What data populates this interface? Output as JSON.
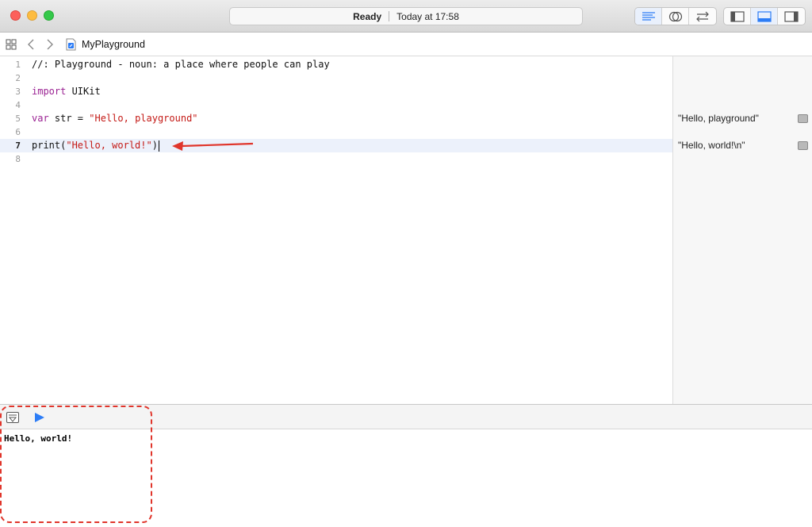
{
  "window": {
    "status_ready": "Ready",
    "status_time": "Today at 17:58"
  },
  "toolbar": {
    "editor_modes": [
      "standard-editor-icon",
      "assistant-editor-icon",
      "version-editor-icon"
    ],
    "view_toggles": [
      "navigator-panel-icon",
      "debug-area-icon",
      "utilities-panel-icon"
    ]
  },
  "jumpbar": {
    "file_name": "MyPlayground"
  },
  "editor": {
    "lines": [
      {
        "num": "1",
        "text": "//: Playground - noun: a place where people can play"
      },
      {
        "num": "2",
        "text": ""
      },
      {
        "num": "3",
        "kw": "import",
        "rest": " UIKit"
      },
      {
        "num": "4",
        "text": ""
      },
      {
        "num": "5",
        "kw": "var",
        "mid": " str = ",
        "str": "\"Hello, playground\""
      },
      {
        "num": "6",
        "text": ""
      },
      {
        "num": "7",
        "pre": "print(",
        "str": "\"Hello, world!\"",
        "post": ")"
      },
      {
        "num": "8",
        "text": ""
      }
    ],
    "current_line": 7
  },
  "results": [
    {
      "text": "\"Hello, playground\""
    },
    {
      "text": "\"Hello, world!\\n\""
    }
  ],
  "console": {
    "output": "Hello, world!"
  },
  "colors": {
    "annotation": "#e0352b",
    "accent": "#2d7df6"
  }
}
